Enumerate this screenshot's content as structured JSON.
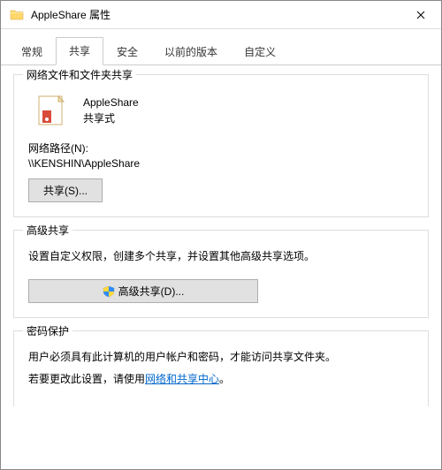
{
  "window": {
    "title": "AppleShare 属性"
  },
  "tabs": [
    {
      "label": "常规"
    },
    {
      "label": "共享"
    },
    {
      "label": "安全"
    },
    {
      "label": "以前的版本"
    },
    {
      "label": "自定义"
    }
  ],
  "network_sharing": {
    "legend": "网络文件和文件夹共享",
    "folder_name": "AppleShare",
    "folder_status": "共享式",
    "path_label": "网络路径(N):",
    "path_value": "\\\\KENSHIN\\AppleShare",
    "share_button": "共享(S)..."
  },
  "advanced_sharing": {
    "legend": "高级共享",
    "description": "设置自定义权限，创建多个共享，并设置其他高级共享选项。",
    "button": "高级共享(D)..."
  },
  "password": {
    "legend": "密码保护",
    "line1": "用户必须具有此计算机的用户帐户和密码，才能访问共享文件夹。",
    "line2_prefix": "若要更改此设置，请使用",
    "line2_link": "网络和共享中心",
    "line2_suffix": "。"
  }
}
